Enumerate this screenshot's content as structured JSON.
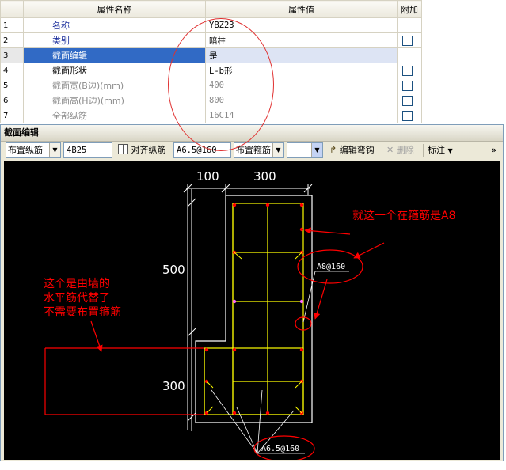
{
  "grid": {
    "col_name": "属性名称",
    "col_value": "属性值",
    "col_extra": "附加",
    "rows": [
      {
        "num": "1",
        "name": "名称",
        "value": "YBZ23",
        "checkbox": false
      },
      {
        "num": "2",
        "name": "类别",
        "value": "暗柱",
        "checkbox": true
      },
      {
        "num": "3",
        "name": "截面编辑",
        "value": "是",
        "checkbox": false
      },
      {
        "num": "4",
        "name": "截面形状",
        "value": "L-b形",
        "checkbox": true
      },
      {
        "num": "5",
        "name": "截面宽(B边)(mm)",
        "value": "400",
        "checkbox": true
      },
      {
        "num": "6",
        "name": "截面高(H边)(mm)",
        "value": "800",
        "checkbox": true
      },
      {
        "num": "7",
        "name": "全部纵筋",
        "value": "16C14",
        "checkbox": true
      }
    ]
  },
  "editor": {
    "title": "截面编辑",
    "toolbar": {
      "place_long_bar": "布置纵筋",
      "long_bar_value": "4B25",
      "align_long_bar": "对齐纵筋",
      "stirrup_value": "A6.5@160",
      "place_stirrup": "布置箍筋",
      "stirrup_type": "",
      "edit_hook": "编辑弯钩",
      "delete": "删除",
      "annotate": "标注",
      "more": "»"
    }
  },
  "drawing": {
    "dim_top_left": "100",
    "dim_top_right": "300",
    "dim_left_upper": "500",
    "dim_left_lower": "300",
    "label_a8": "A8@160",
    "label_a65": "A6.5@160",
    "note_stirrup_line1": "就这一个在箍筋是A8",
    "note_wall_line1": "这个是由墙的",
    "note_wall_line2": "水平筋代替了",
    "note_wall_line3": "不需要布置箍筋",
    "colors": {
      "background": "#000000",
      "outline": "#ffffff",
      "stirrup": "#ffff00",
      "bar": "#ff0000",
      "annotation": "#ff0000",
      "highlight": "#ff66ff"
    }
  }
}
